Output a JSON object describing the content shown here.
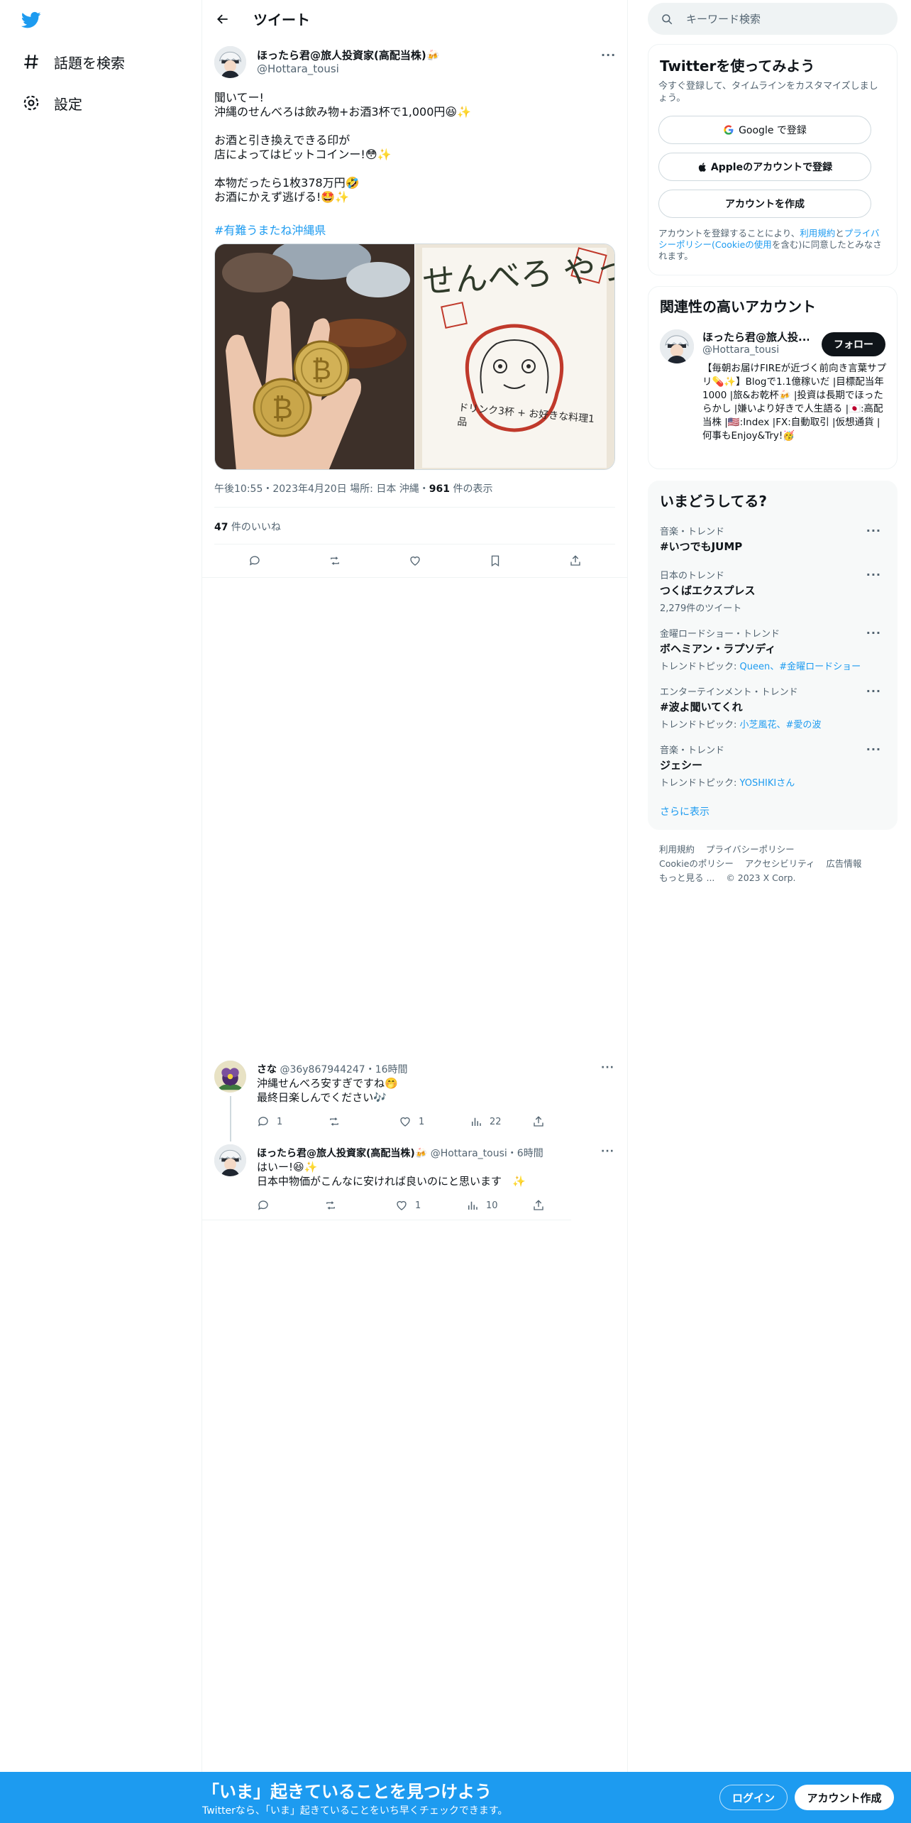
{
  "nav": {
    "explore_label": "話題を検索",
    "settings_label": "設定"
  },
  "header": {
    "title": "ツイート"
  },
  "tweet": {
    "author_name": "ほったら君@旅人投資家(高配当株)🍻",
    "author_handle": "@Hottara_tousi",
    "lines": [
      "聞いてー!",
      "沖縄のせんべろは飲み物+お酒3杯で1,000円😆✨",
      "",
      "お酒と引き換えできる印が",
      "店によってはビットコインー!😳✨",
      "",
      "本物だったら1枚378万円🤣",
      "お酒にかえず逃げる!🤩✨"
    ],
    "hashtag": "#有難うまたね沖縄県",
    "image_right_text": "せんべろ やってます♡",
    "image_right_sub": "ドリンク3杯 + お好きな料理1品",
    "timestamp": "午後10:55・2023年4月20日 場所: 日本 沖縄・",
    "views_count": "961",
    "views_label": " 件の表示",
    "likes_count": "47",
    "likes_label": " 件のいいね"
  },
  "replies": [
    {
      "name": "さな",
      "handle": "@36y867944247",
      "time": "・16時間",
      "line1": "沖縄せんべろ安すぎですね🤭",
      "line2": "最終日楽しんでください🎶",
      "replies": "1",
      "likes": "1",
      "views": "22"
    },
    {
      "name": "ほったら君@旅人投資家(高配当株)🍻",
      "handle": "@Hottara_tousi",
      "time": "・6時間",
      "line1": "はいー!😆✨",
      "line2": "日本中物価がこんなに安ければ良いのにと思います　✨",
      "replies": "",
      "likes": "1",
      "views": "10"
    }
  ],
  "search": {
    "placeholder": "キーワード検索"
  },
  "signup": {
    "title": "Twitterを使ってみよう",
    "desc": "今すぐ登録して、タイムラインをカスタマイズしましょう。",
    "google": "Google で登録",
    "apple": "Appleのアカウントで登録",
    "create": "アカウントを作成",
    "terms_1": "アカウントを登録することにより、",
    "terms_link1": "利用規約",
    "terms_2": "と",
    "terms_link2": "プライバシーポリシー(Cookieの使用",
    "terms_3": "を含む)に同意したとみなされます。"
  },
  "relevant": {
    "title": "関連性の高いアカウント",
    "name": "ほったら君@旅人投...",
    "handle": "@Hottara_tousi",
    "follow": "フォロー",
    "bio": "【毎朝お届けFIREが近づく前向き言葉サプリ💊✨】Blogで1.1億稼いだ |目標配当年1000 |旅&お乾杯🍻 |投資は長期でほったらかし |嫌いより好きで人生語る |🇯🇵:高配当株 |🇺🇸:Index |FX:自動取引 |仮想通貨 |何事もEnjoy&Try!🥳"
  },
  "trends": {
    "title": "いまどうしてる?",
    "items": [
      {
        "meta": "音楽・トレンド",
        "name": "#いつでもJUMP",
        "sub_prefix": "",
        "sub_links": ""
      },
      {
        "meta": "日本のトレンド",
        "name": "つくばエクスプレス",
        "sub_prefix": "2,279件のツイート",
        "sub_links": ""
      },
      {
        "meta": "金曜ロードショー・トレンド",
        "name": "ボヘミアン・ラプソディ",
        "sub_prefix": "トレンドトピック: ",
        "sub_links": "Queen、#金曜ロードショー"
      },
      {
        "meta": "エンターテインメント・トレンド",
        "name": "#波よ聞いてくれ",
        "sub_prefix": "トレンドトピック: ",
        "sub_links": "小芝風花、#愛の波"
      },
      {
        "meta": "音楽・トレンド",
        "name": "ジェシー",
        "sub_prefix": "トレンドトピック: ",
        "sub_links": "YOSHIKIさん"
      }
    ],
    "show_more": "さらに表示"
  },
  "footer": {
    "row1": [
      "利用規約",
      "プライバシーポリシー"
    ],
    "row2": [
      "Cookieのポリシー",
      "アクセシビリティ",
      "広告情報"
    ],
    "more": "もっと見る ...",
    "copyright": "© 2023 X Corp."
  },
  "bottombar": {
    "title": "「いま」起きていることを見つけよう",
    "subtitle": "Twitterなら、「いま」起きていることをいち早くチェックできます。",
    "login": "ログイン",
    "signup": "アカウント作成"
  },
  "colors": {
    "brand": "#1d9bf0",
    "text": "#0f1419",
    "secondary": "#536471"
  }
}
